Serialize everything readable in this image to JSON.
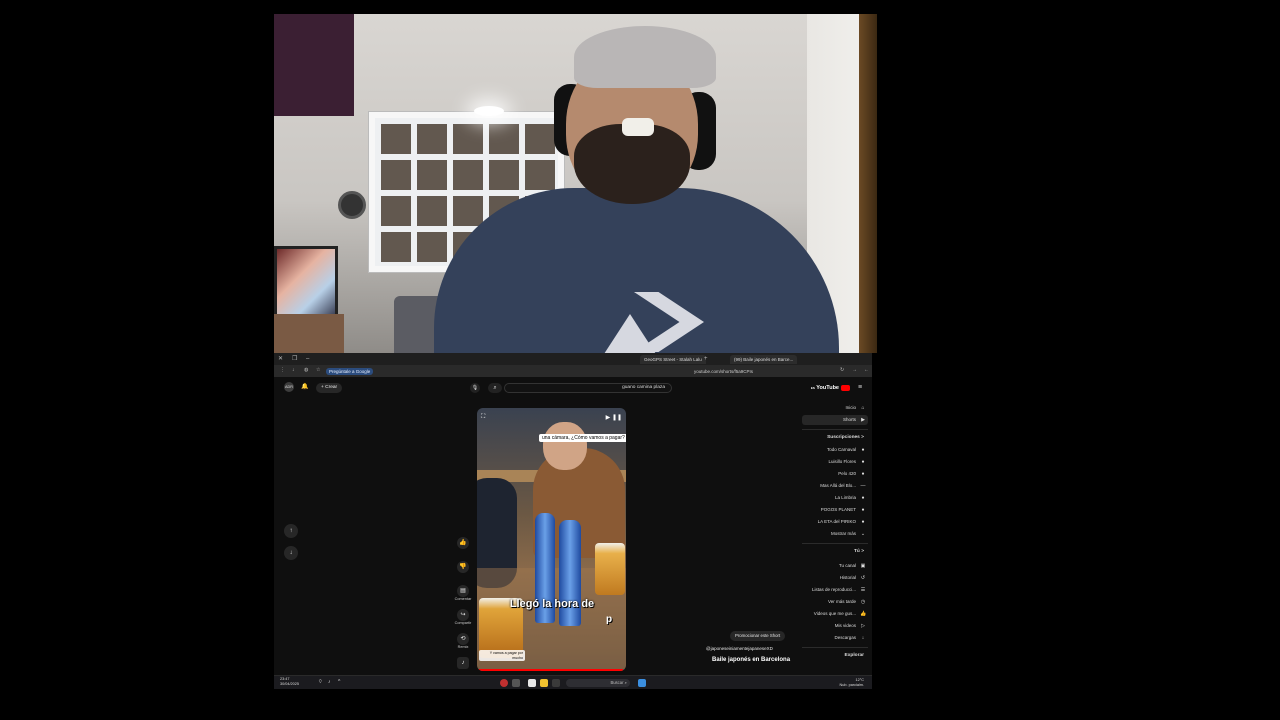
{
  "browser": {
    "tabs": [
      {
        "label": "(99) Baile japonés en Barce..."
      },
      {
        "label": "GeoGPS Street - Stalah Lalu"
      }
    ],
    "url": "youtube.com/shorts/f5a9CPIs",
    "gemini_label": "Pregúntale a Google"
  },
  "youtube": {
    "logo": "YouTube",
    "logo_suffix": "ES",
    "search_value": "guano camina plaza",
    "create_label": "+ Crear",
    "avatar_label": "ADR"
  },
  "sidebar": {
    "items": [
      {
        "label": "Inicio",
        "icon": "home-icon"
      },
      {
        "label": "Shorts",
        "icon": "shorts-icon"
      }
    ],
    "subs_heading": "Suscripciones >",
    "subs": [
      {
        "label": "Todo Carnaval"
      },
      {
        "label": "Luisillo Flores"
      },
      {
        "label": "Pelo 420"
      },
      {
        "label": "Mas Allá del Blo..."
      },
      {
        "label": "La Limbria"
      },
      {
        "label": "POGOS PLANET"
      },
      {
        "label": "LA ETA del PIRIKO"
      },
      {
        "label": "Mostrar más"
      }
    ],
    "you_heading": "Tú >",
    "you_items": [
      {
        "label": "Tu canal"
      },
      {
        "label": "Historial"
      },
      {
        "label": "Listas de reproducci..."
      },
      {
        "label": "Ver más tarde"
      },
      {
        "label": "Videos que me gus..."
      },
      {
        "label": "Mis videos"
      },
      {
        "label": "Descargas"
      }
    ],
    "explore_heading": "Explorar"
  },
  "short": {
    "caption_top": "una cámara, ¿Cómo vamos a pagar?",
    "caption_big": "Llegó la hora de",
    "caption_p": "p",
    "bottom_caption": "Y vamos a pagar por mucho",
    "progress": 0.98
  },
  "actions": [
    {
      "label": "",
      "icon": "like-icon"
    },
    {
      "label": "",
      "icon": "dislike-icon"
    },
    {
      "label": "Comentar",
      "icon": "comment-icon"
    },
    {
      "label": "Compartir",
      "icon": "share-icon"
    },
    {
      "label": "Remix",
      "icon": "remix-icon"
    }
  ],
  "video": {
    "promote_label": "Promocionar este Short",
    "channel": "@japoneseiniamentejapaneseXD",
    "title": "Baile japonés en Barcelona"
  },
  "taskbar": {
    "search_placeholder": "Buscar",
    "time": "23:47",
    "date": "30/04/2025",
    "weather": "12°C",
    "weather_desc": "Nub. parcialm."
  }
}
